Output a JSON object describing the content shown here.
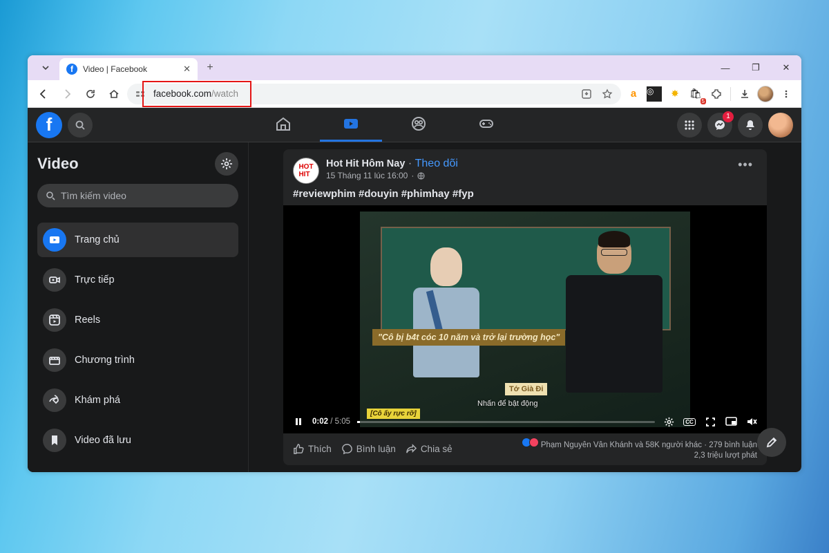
{
  "browser": {
    "tab_title": "Video | Facebook",
    "url_domain": "facebook.com",
    "url_path": "/watch",
    "window_buttons": {
      "min": "—",
      "max": "❐",
      "close": "✕"
    },
    "notification_badge_ext": "5"
  },
  "fb": {
    "messenger_badge": "1"
  },
  "sidebar": {
    "title": "Video",
    "search_placeholder": "Tìm kiếm video",
    "items": [
      {
        "label": "Trang chủ"
      },
      {
        "label": "Trực tiếp"
      },
      {
        "label": "Reels"
      },
      {
        "label": "Chương trình"
      },
      {
        "label": "Khám phá"
      },
      {
        "label": "Video đã lưu"
      }
    ]
  },
  "post": {
    "author": "Hot Hit Hôm Nay",
    "separator": " · ",
    "follow": "Theo dõi",
    "time": "15 Tháng 11 lúc 16:00",
    "caption": "#reviewphim #douyin #phimhay #fyp",
    "video": {
      "current": "0:02",
      "total": "5:05",
      "sep": " / ",
      "sub_main": "\"Cô bị b4t cóc 10 năm và trở lại trường học\"",
      "sub_small1": "Tớ Già Đi",
      "sub_small2": "[Cô ấy rực rỡ]",
      "sub_center": "Nhấn để bật động"
    },
    "actions": {
      "like": "Thích",
      "comment": "Bình luận",
      "share": "Chia sẻ"
    },
    "stats": {
      "likers": "Phạm Nguyên Vân Khánh và 58K người khác",
      "comments": "279 bình luận",
      "views": "2,3 triệu lượt phát"
    }
  }
}
